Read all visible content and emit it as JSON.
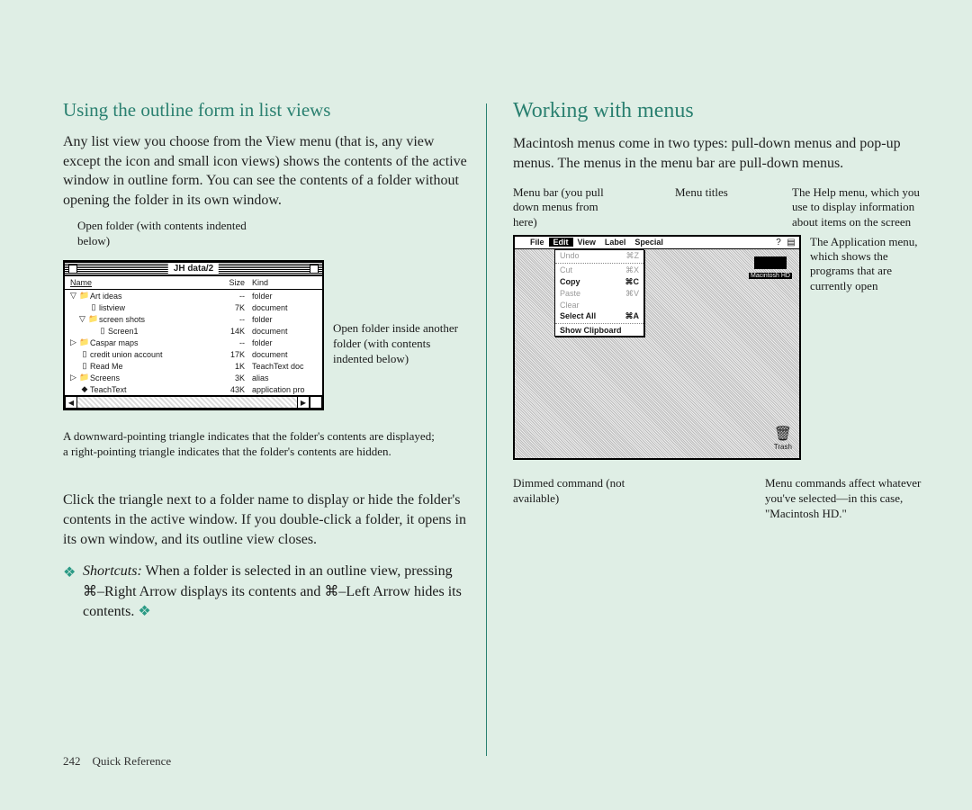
{
  "left": {
    "heading": "Using the outline form in list views",
    "para1": "Any list view you choose from the View menu (that is, any view except the icon and small icon views) shows the contents of the active window in outline form. You can see the contents of a folder without opening the folder in its own window.",
    "annot_open_folder": "Open folder (with contents indented below)",
    "annot_open_inside": "Open folder inside another folder (with contents indented below)",
    "annot_triangle": "A downward-pointing triangle indicates that the folder's contents are displayed; a right-pointing triangle indicates that the folder's contents are hidden.",
    "para2": "Click the triangle next to a folder name to display or hide the folder's contents in the active window. If you double-click a folder, it opens in its own window, and its outline view closes.",
    "shortcuts_label": "Shortcuts:",
    "shortcuts_text": "When a folder is selected in an outline view, pressing ⌘–Right Arrow displays its contents and ⌘–Left Arrow hides its contents.",
    "diamond": "❖",
    "finder": {
      "title": "JH data/2",
      "cols": {
        "name": "Name",
        "size": "Size",
        "kind": "Kind"
      },
      "rows": [
        {
          "tri": "▽",
          "indent": 0,
          "icon": "📁",
          "name": "Art ideas",
          "size": "--",
          "kind": "folder"
        },
        {
          "tri": "",
          "indent": 1,
          "icon": "▯",
          "name": "listview",
          "size": "7K",
          "kind": "document"
        },
        {
          "tri": "▽",
          "indent": 1,
          "icon": "📁",
          "name": "screen shots",
          "size": "--",
          "kind": "folder"
        },
        {
          "tri": "",
          "indent": 2,
          "icon": "▯",
          "name": "Screen1",
          "size": "14K",
          "kind": "document"
        },
        {
          "tri": "▷",
          "indent": 0,
          "icon": "📁",
          "name": "Caspar maps",
          "size": "--",
          "kind": "folder"
        },
        {
          "tri": "",
          "indent": 0,
          "icon": "▯",
          "name": "credit union account",
          "size": "17K",
          "kind": "document"
        },
        {
          "tri": "",
          "indent": 0,
          "icon": "▯",
          "name": "Read Me",
          "size": "1K",
          "kind": "TeachText doc"
        },
        {
          "tri": "▷",
          "indent": 0,
          "icon": "📁",
          "name": "Screens",
          "size": "3K",
          "kind": "alias"
        },
        {
          "tri": "",
          "indent": 0,
          "icon": "◆",
          "name": "TeachText",
          "size": "43K",
          "kind": "application pro"
        }
      ]
    }
  },
  "right": {
    "heading": "Working with menus",
    "para1": "Macintosh menus come in two types: pull-down menus and pop-up menus. The menus in the menu bar are pull-down menus.",
    "callouts": {
      "menubar": "Menu bar (you pull down menus from here)",
      "titles": "Menu titles",
      "help": "The Help menu, which you use to display information about items on the screen",
      "appmenu": "The Application menu, which shows the programs that are currently open",
      "dimmed": "Dimmed command (not available)",
      "affect": "Menu commands affect whatever you've selected—in this case, \"Macintosh HD.\""
    },
    "menubar": {
      "apple": "",
      "items": [
        "File",
        "Edit",
        "View",
        "Label",
        "Special"
      ],
      "help_icon": "?",
      "app_icon": "▤"
    },
    "editmenu": [
      {
        "label": "Undo",
        "sc": "⌘Z",
        "dim": true
      },
      {
        "hr": true
      },
      {
        "label": "Cut",
        "sc": "⌘X",
        "dim": true
      },
      {
        "label": "Copy",
        "sc": "⌘C",
        "bold": true
      },
      {
        "label": "Paste",
        "sc": "⌘V",
        "dim": true
      },
      {
        "label": "Clear",
        "sc": "",
        "dim": true
      },
      {
        "label": "Select All",
        "sc": "⌘A",
        "bold": true
      },
      {
        "hr": true
      },
      {
        "label": "Show Clipboard",
        "sc": "",
        "bold": true
      }
    ],
    "hd_label": "Macintosh HD",
    "trash_label": "Trash"
  },
  "footer": {
    "page": "242",
    "title": "Quick Reference"
  }
}
